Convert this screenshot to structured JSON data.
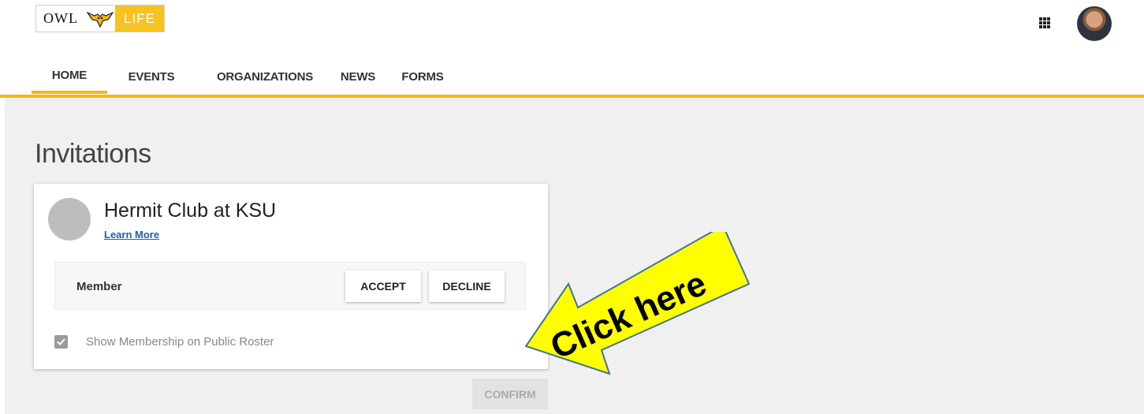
{
  "header": {
    "logo_left": "Owl",
    "logo_right": "Life",
    "icons": [
      "owl-bird-icon",
      "apps-grid-icon",
      "user-avatar"
    ]
  },
  "nav": {
    "items": [
      {
        "label": "HOME",
        "active": true
      },
      {
        "label": "EVENTS",
        "active": false
      },
      {
        "label": "ORGANIZATIONS",
        "active": false
      },
      {
        "label": "NEWS",
        "active": false
      },
      {
        "label": "FORMS",
        "active": false
      }
    ]
  },
  "page": {
    "title": "Invitations"
  },
  "invitation": {
    "org_name": "Hermit Club at KSU",
    "learn_more": "Learn More",
    "role": "Member",
    "accept_label": "ACCEPT",
    "decline_label": "DECLINE",
    "show_on_roster_label": "Show Membership on Public Roster",
    "show_on_roster_checked": true
  },
  "confirm_label": "CONFIRM",
  "annotation": {
    "text": "Click here"
  },
  "colors": {
    "accent": "#f5b51b",
    "logo_life_bg": "#f5c322",
    "link": "#1a5fb4",
    "callout_fill": "#ffff00",
    "callout_stroke": "#41719c"
  }
}
